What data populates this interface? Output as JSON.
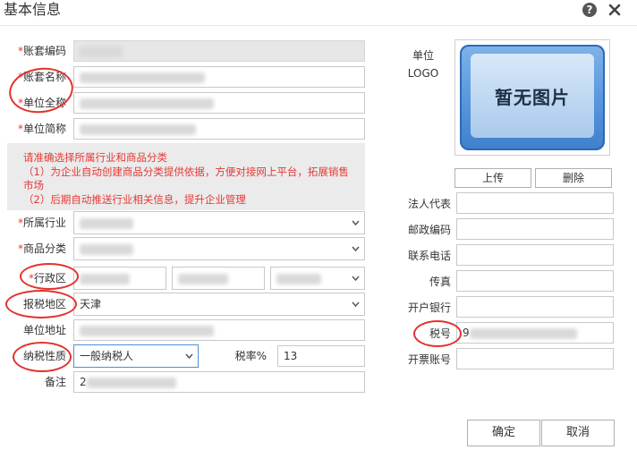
{
  "dialog": {
    "title": "基本信息",
    "help_icon": "help-icon",
    "close_icon": "close-icon"
  },
  "left": {
    "account_code": {
      "label": "账套编码",
      "required": "*"
    },
    "account_name": {
      "label": "账套名称",
      "required": "*"
    },
    "unit_fullname": {
      "label": "单位全称",
      "required": "*"
    },
    "unit_shortname": {
      "label": "单位简称",
      "required": "*"
    },
    "notice": {
      "line1": "请准确选择所属行业和商品分类",
      "line2": "（1）为企业自动创建商品分类提供依据，方便对接网上平台，拓展销售市场",
      "line3": "（2）后期自动推送行业相关信息，提升企业管理"
    },
    "industry": {
      "label": "所属行业",
      "required": "*"
    },
    "goods_category": {
      "label": "商品分类",
      "required": "*"
    },
    "region": {
      "label": "行政区",
      "required": "*"
    },
    "tax_area": {
      "label": "报税地区",
      "value": "天津"
    },
    "address": {
      "label": "单位地址"
    },
    "tax_nature": {
      "label": "纳税性质",
      "value": "一般纳税人"
    },
    "tax_rate": {
      "label": "税率%",
      "value": "13"
    },
    "remark": {
      "label": "备注",
      "value": "2"
    }
  },
  "right": {
    "logo_label_1": "单位",
    "logo_label_2": "LOGO",
    "logo_placeholder": "暂无图片",
    "upload_button": "上传",
    "delete_button": "删除",
    "legal_rep": "法人代表",
    "postcode": "邮政编码",
    "phone": "联系电话",
    "fax": "传真",
    "bank": "开户银行",
    "tax_no": {
      "label": "税号",
      "value": "9"
    },
    "invoice_account": "开票账号"
  },
  "footer": {
    "ok": "确定",
    "cancel": "取消"
  },
  "colors": {
    "required": "#e53935",
    "annotation": "#e3312d",
    "notice_bg": "#ebebeb"
  }
}
